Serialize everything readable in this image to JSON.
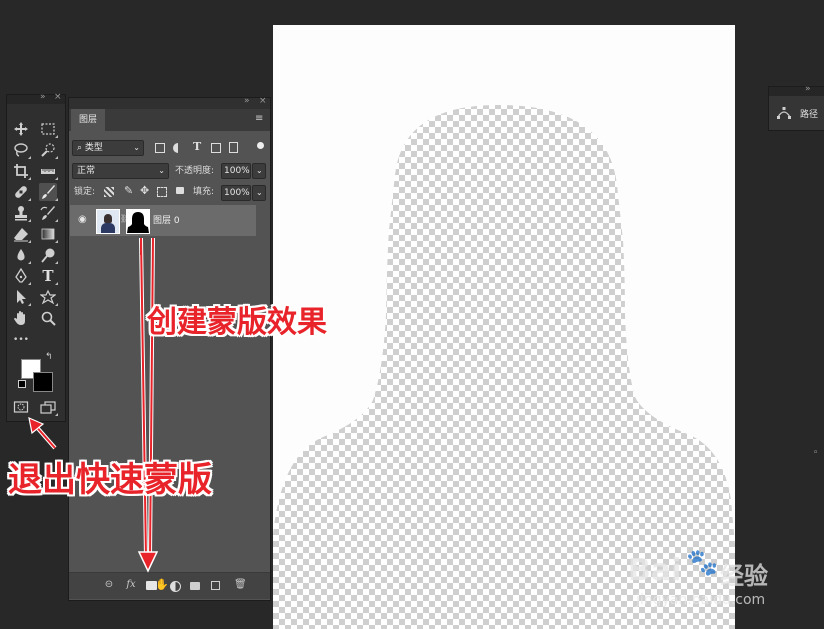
{
  "colors": {
    "annotation": "#e8232a",
    "canvas": "#fdfdfd",
    "panel": "#535353"
  },
  "tools": [
    {
      "name": "move-tool",
      "icon": "move-icon"
    },
    {
      "name": "marquee-tool",
      "icon": "rect-marquee-icon"
    },
    {
      "name": "lasso-tool",
      "icon": "lasso-icon"
    },
    {
      "name": "quick-select-tool",
      "icon": "quick-select-icon"
    },
    {
      "name": "crop-tool",
      "icon": "crop-icon"
    },
    {
      "name": "ruler-tool",
      "icon": "ruler-icon"
    },
    {
      "name": "healing-tool",
      "icon": "bandage-icon"
    },
    {
      "name": "brush-tool",
      "icon": "brush-icon"
    },
    {
      "name": "stamp-tool",
      "icon": "stamp-icon"
    },
    {
      "name": "history-brush-tool",
      "icon": "history-brush-icon"
    },
    {
      "name": "eraser-tool",
      "icon": "eraser-icon"
    },
    {
      "name": "gradient-tool",
      "icon": "gradient-icon"
    },
    {
      "name": "blur-tool",
      "icon": "drop-icon"
    },
    {
      "name": "dodge-tool",
      "icon": "dodge-icon"
    },
    {
      "name": "pen-tool",
      "icon": "pen-icon"
    },
    {
      "name": "type-tool",
      "icon": "type-icon"
    },
    {
      "name": "path-select-tool",
      "icon": "arrow-icon"
    },
    {
      "name": "shape-tool",
      "icon": "custom-shape-icon"
    },
    {
      "name": "hand-tool",
      "icon": "hand-icon"
    },
    {
      "name": "zoom-tool",
      "icon": "zoom-icon"
    }
  ],
  "tools_glyph": {
    "type": "T",
    "more": "•••"
  },
  "layers_panel": {
    "tab_label": "图层",
    "filter_label": "类型",
    "blend_mode": "正常",
    "opacity_label": "不透明度:",
    "opacity_value": "100%",
    "lock_label": "锁定:",
    "fill_label": "填充:",
    "fill_value": "100%",
    "layer_name": "图层 0",
    "fx_label": "fx",
    "type_filter_glyph": "T"
  },
  "paths_panel": {
    "tab_label": "路径"
  },
  "annotations": {
    "mask_effect": "创建蒙版效果",
    "exit_quick_mask": "退出快速蒙版"
  },
  "watermark": {
    "brand": "Bai",
    "brand_suffix": "经验",
    "url": "jingyan.baidu.com"
  }
}
